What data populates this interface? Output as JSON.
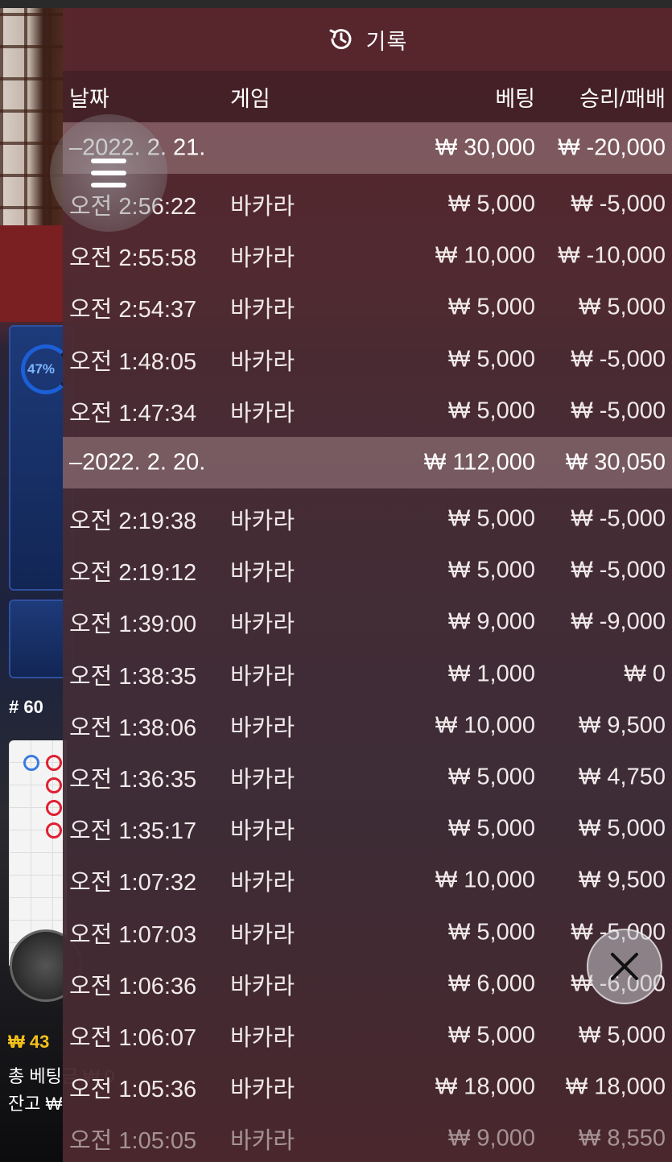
{
  "panel": {
    "title": "기록",
    "headers": {
      "date": "날짜",
      "game": "게임",
      "bet": "베팅",
      "win_loss": "승리/패배"
    }
  },
  "groups": [
    {
      "date": "–2022. 2. 21.",
      "bet_total": "₩ 30,000",
      "wl_total": "₩ -20,000",
      "rows": [
        {
          "time": "오전 2:56:22",
          "game": "바카라",
          "bet": "₩ 5,000",
          "wl": "₩ -5,000"
        },
        {
          "time": "오전 2:55:58",
          "game": "바카라",
          "bet": "₩ 10,000",
          "wl": "₩ -10,000"
        },
        {
          "time": "오전 2:54:37",
          "game": "바카라",
          "bet": "₩ 5,000",
          "wl": "₩ 5,000"
        },
        {
          "time": "오전 1:48:05",
          "game": "바카라",
          "bet": "₩ 5,000",
          "wl": "₩ -5,000"
        },
        {
          "time": "오전 1:47:34",
          "game": "바카라",
          "bet": "₩ 5,000",
          "wl": "₩ -5,000"
        }
      ]
    },
    {
      "date": "–2022. 2. 20.",
      "bet_total": "₩ 112,000",
      "wl_total": "₩ 30,050",
      "rows": [
        {
          "time": "오전 2:19:38",
          "game": "바카라",
          "bet": "₩ 5,000",
          "wl": "₩ -5,000"
        },
        {
          "time": "오전 2:19:12",
          "game": "바카라",
          "bet": "₩ 5,000",
          "wl": "₩ -5,000"
        },
        {
          "time": "오전 1:39:00",
          "game": "바카라",
          "bet": "₩ 9,000",
          "wl": "₩ -9,000"
        },
        {
          "time": "오전 1:38:35",
          "game": "바카라",
          "bet": "₩ 1,000",
          "wl": "₩ 0"
        },
        {
          "time": "오전 1:38:06",
          "game": "바카라",
          "bet": "₩ 10,000",
          "wl": "₩ 9,500"
        },
        {
          "time": "오전 1:36:35",
          "game": "바카라",
          "bet": "₩ 5,000",
          "wl": "₩ 4,750"
        },
        {
          "time": "오전 1:35:17",
          "game": "바카라",
          "bet": "₩ 5,000",
          "wl": "₩ 5,000"
        },
        {
          "time": "오전 1:07:32",
          "game": "바카라",
          "bet": "₩ 10,000",
          "wl": "₩ 9,500"
        },
        {
          "time": "오전 1:07:03",
          "game": "바카라",
          "bet": "₩ 5,000",
          "wl": "₩ -5,000"
        },
        {
          "time": "오전 1:06:36",
          "game": "바카라",
          "bet": "₩ 6,000",
          "wl": "₩ -6,000"
        },
        {
          "time": "오전 1:06:07",
          "game": "바카라",
          "bet": "₩ 5,000",
          "wl": "₩ 5,000"
        },
        {
          "time": "오전 1:05:36",
          "game": "바카라",
          "bet": "₩ 18,000",
          "wl": "₩ 18,000"
        },
        {
          "time": "오전 1:05:05",
          "game": "바카라",
          "bet": "₩ 9,000",
          "wl": "₩ 8,550"
        }
      ]
    }
  ],
  "background": {
    "progress_pct": "47%",
    "round_label": "# 60",
    "balance_partial": "₩ 43",
    "total_bet_label": "총 베팅금 ₩ 0",
    "remaining_label": "잔고 ₩"
  },
  "icons": {
    "history": "history-clock-icon",
    "menu": "hamburger-menu-icon",
    "close": "close-x-icon"
  }
}
